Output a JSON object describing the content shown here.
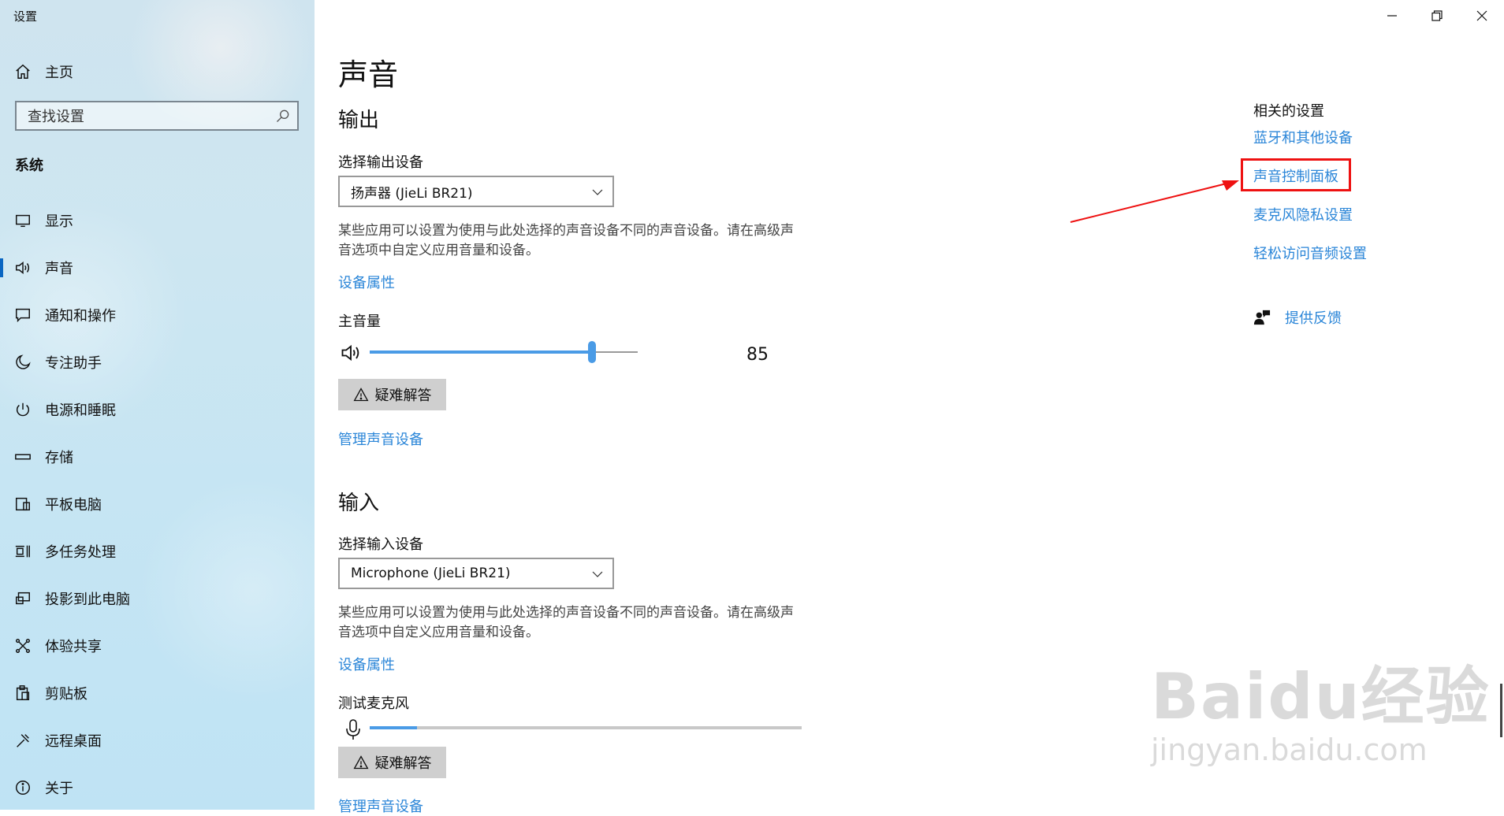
{
  "window": {
    "title": "设置"
  },
  "sidebar": {
    "home_label": "主页",
    "search_placeholder": "查找设置",
    "section": "系统",
    "items": [
      {
        "label": "显示",
        "icon": "display-icon"
      },
      {
        "label": "声音",
        "icon": "speaker-icon",
        "active": true
      },
      {
        "label": "通知和操作",
        "icon": "notification-icon"
      },
      {
        "label": "专注助手",
        "icon": "moon-icon"
      },
      {
        "label": "电源和睡眠",
        "icon": "power-icon"
      },
      {
        "label": "存储",
        "icon": "storage-icon"
      },
      {
        "label": "平板电脑",
        "icon": "tablet-icon"
      },
      {
        "label": "多任务处理",
        "icon": "multitask-icon"
      },
      {
        "label": "投影到此电脑",
        "icon": "project-icon"
      },
      {
        "label": "体验共享",
        "icon": "share-icon"
      },
      {
        "label": "剪贴板",
        "icon": "clipboard-icon"
      },
      {
        "label": "远程桌面",
        "icon": "remote-desktop-icon"
      },
      {
        "label": "关于",
        "icon": "info-icon"
      }
    ]
  },
  "main": {
    "title": "声音",
    "output": {
      "heading": "输出",
      "device_label": "选择输出设备",
      "device_value": "扬声器 (JieLi BR21)",
      "description": "某些应用可以设置为使用与此处选择的声音设备不同的声音设备。请在高级声音选项中自定义应用音量和设备。",
      "properties_link": "设备属性",
      "volume_label": "主音量",
      "volume_value": "85",
      "volume_level": 0.83,
      "troubleshoot": "疑难解答",
      "manage_link": "管理声音设备"
    },
    "input": {
      "heading": "输入",
      "device_label": "选择输入设备",
      "device_value": "Microphone (JieLi BR21)",
      "description": "某些应用可以设置为使用与此处选择的声音设备不同的声音设备。请在高级声音选项中自定义应用音量和设备。",
      "properties_link": "设备属性",
      "test_label": "测试麦克风",
      "mic_level": 0.11,
      "troubleshoot": "疑难解答",
      "manage_link": "管理声音设备"
    }
  },
  "related": {
    "heading": "相关的设置",
    "links": [
      "蓝牙和其他设备",
      "声音控制面板",
      "麦克风隐私设置",
      "轻松访问音频设置"
    ],
    "feedback": "提供反馈"
  },
  "watermark": {
    "line1": "Baidu经验",
    "line2": "jingyan.baidu.com"
  },
  "colors": {
    "accent": "#4a9be6",
    "link": "#2b86d8",
    "highlight": "#ee1111"
  }
}
